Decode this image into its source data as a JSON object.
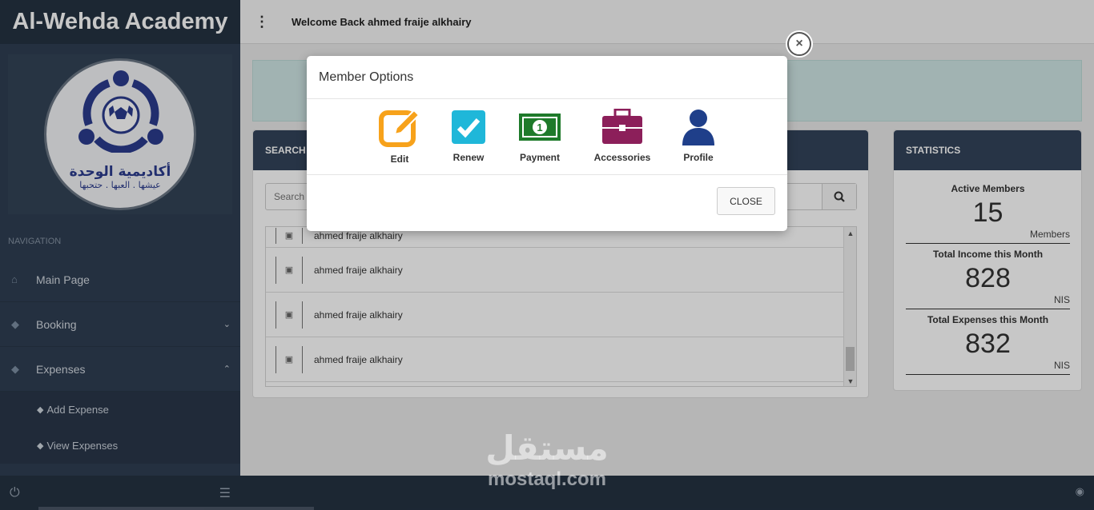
{
  "sidebar": {
    "brand": "Al-Wehda Academy",
    "logo_text_line1": "أكاديمية الوحدة",
    "logo_text_line2": "عيشها . العبها . حتحبها",
    "nav_heading": "NAVIGATION",
    "items": [
      {
        "label": "Main Page",
        "icon": "home-icon"
      },
      {
        "label": "Booking",
        "icon": "tag-icon"
      },
      {
        "label": "Expenses",
        "icon": "tag-icon"
      }
    ],
    "subitems": [
      {
        "label": "Add Expense",
        "icon": "tag-icon"
      },
      {
        "label": "View Expenses",
        "icon": "tag-icon"
      }
    ]
  },
  "topbar": {
    "welcome": "Welcome Back ahmed fraije alkhairy"
  },
  "search_panel": {
    "title": "SEARCH B",
    "placeholder": "Search",
    "members": [
      "ahmed fraije alkhairy",
      "ahmed fraije alkhairy",
      "ahmed fraije alkhairy",
      "ahmed fraije alkhairy"
    ]
  },
  "statistics": {
    "title": "STATISTICS",
    "items": [
      {
        "label": "Active Members",
        "value": "15",
        "unit": "Members"
      },
      {
        "label": "Total Income this Month",
        "value": "828",
        "unit": "NIS"
      },
      {
        "label": "Total Expenses this Month",
        "value": "832",
        "unit": "NIS"
      }
    ]
  },
  "modal": {
    "title": "Member Options",
    "options": [
      {
        "label": "Edit",
        "icon": "edit-icon",
        "color": "#f7a21b"
      },
      {
        "label": "Renew",
        "icon": "check-icon",
        "color": "#1fb7d9"
      },
      {
        "label": "Payment",
        "icon": "money-icon",
        "color": "#1e7a2a"
      },
      {
        "label": "Accessories",
        "icon": "briefcase-icon",
        "color": "#8c1f5a"
      },
      {
        "label": "Profile",
        "icon": "user-icon",
        "color": "#1f3f8a"
      }
    ],
    "close_label": "CLOSE"
  },
  "watermark": {
    "ar": "مستقل",
    "en": "mostaql.com"
  }
}
